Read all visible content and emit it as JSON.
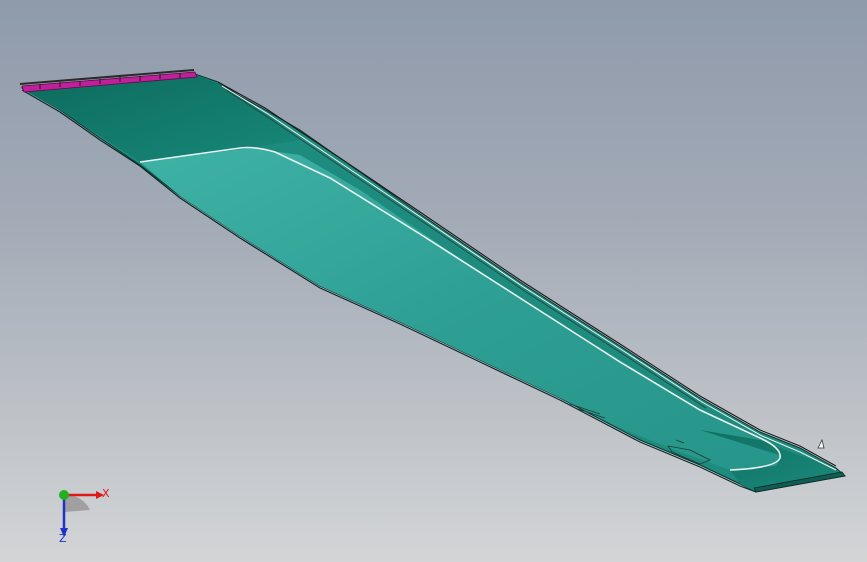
{
  "viewport": {
    "background_top": "#8f9aab",
    "background_bottom": "#d3d5d7"
  },
  "model": {
    "part": "wing-panel",
    "surface_color": "#2a9c92",
    "surface_dark_color": "#0f6e60",
    "edge_color": "#1a1a1a",
    "highlight_edge_color": "#e8f4f2",
    "selected_edge_color": "#c0209a"
  },
  "triad": {
    "x_label": "X",
    "z_label": "Z",
    "x_color": "#e01818",
    "y_color": "#22b022",
    "z_color": "#2030c8"
  }
}
